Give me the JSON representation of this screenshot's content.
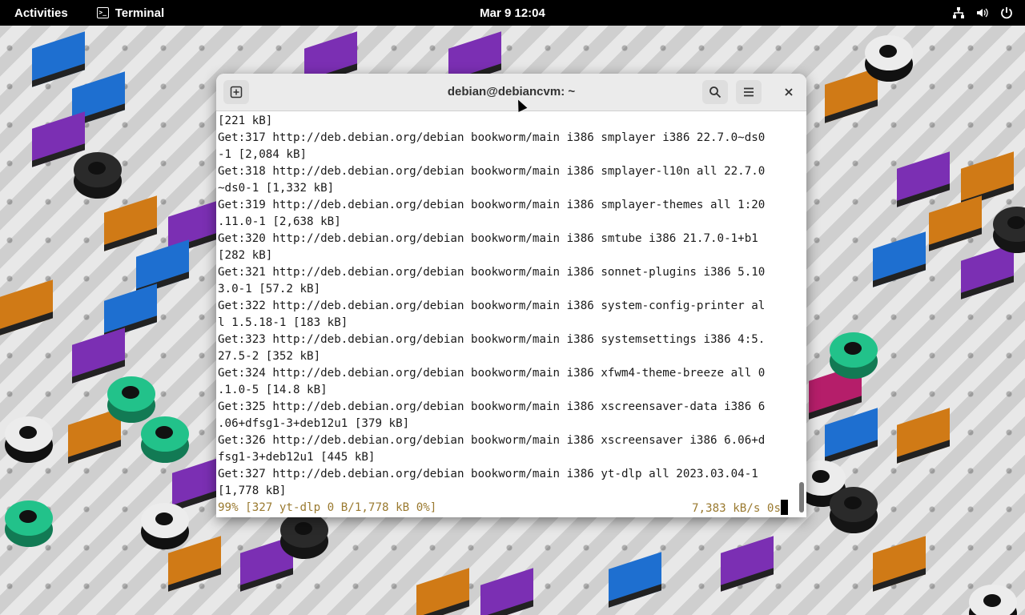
{
  "topbar": {
    "activities": "Activities",
    "app_name": "Terminal",
    "clock": "Mar 9  12:04"
  },
  "window": {
    "title": "debian@debiancvm: ~"
  },
  "terminal": {
    "lines": [
      "[221 kB]",
      "Get:317 http://deb.debian.org/debian bookworm/main i386 smplayer i386 22.7.0~ds0",
      "-1 [2,084 kB]",
      "Get:318 http://deb.debian.org/debian bookworm/main i386 smplayer-l10n all 22.7.0",
      "~ds0-1 [1,332 kB]",
      "Get:319 http://deb.debian.org/debian bookworm/main i386 smplayer-themes all 1:20",
      ".11.0-1 [2,638 kB]",
      "Get:320 http://deb.debian.org/debian bookworm/main i386 smtube i386 21.7.0-1+b1",
      "[282 kB]",
      "Get:321 http://deb.debian.org/debian bookworm/main i386 sonnet-plugins i386 5.10",
      "3.0-1 [57.2 kB]",
      "Get:322 http://deb.debian.org/debian bookworm/main i386 system-config-printer al",
      "l 1.5.18-1 [183 kB]",
      "Get:323 http://deb.debian.org/debian bookworm/main i386 systemsettings i386 4:5.",
      "27.5-2 [352 kB]",
      "Get:324 http://deb.debian.org/debian bookworm/main i386 xfwm4-theme-breeze all 0",
      ".1.0-5 [14.8 kB]",
      "Get:325 http://deb.debian.org/debian bookworm/main i386 xscreensaver-data i386 6",
      ".06+dfsg1-3+deb12u1 [379 kB]",
      "Get:326 http://deb.debian.org/debian bookworm/main i386 xscreensaver i386 6.06+d",
      "fsg1-3+deb12u1 [445 kB]",
      "Get:327 http://deb.debian.org/debian bookworm/main i386 yt-dlp all 2023.03.04-1",
      "[1,778 kB]"
    ],
    "progress_left": "99% [327 yt-dlp 0 B/1,778 kB 0%]",
    "progress_right": "7,383 kB/s 0s"
  }
}
